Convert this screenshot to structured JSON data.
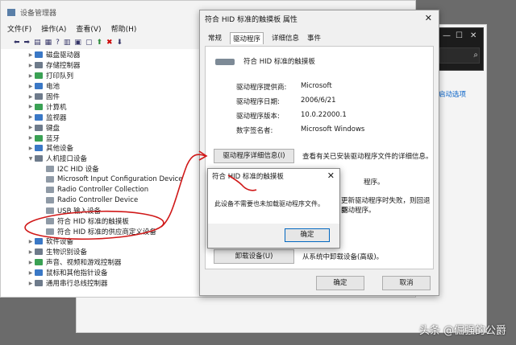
{
  "device_manager": {
    "title": "设备管理器",
    "menu": [
      "文件(F)",
      "操作(A)",
      "查看(V)",
      "帮助(H)"
    ],
    "tree": [
      {
        "label": "磁盘驱动器",
        "level": 1,
        "icon": "disk-icon"
      },
      {
        "label": "存储控制器",
        "level": 1,
        "icon": "storage-icon"
      },
      {
        "label": "打印队列",
        "level": 1,
        "icon": "printer-icon"
      },
      {
        "label": "电池",
        "level": 1,
        "icon": "battery-icon"
      },
      {
        "label": "固件",
        "level": 1,
        "icon": "firmware-icon"
      },
      {
        "label": "计算机",
        "level": 1,
        "icon": "computer-icon"
      },
      {
        "label": "监视器",
        "level": 1,
        "icon": "monitor-icon"
      },
      {
        "label": "键盘",
        "level": 1,
        "icon": "keyboard-icon"
      },
      {
        "label": "蓝牙",
        "level": 1,
        "icon": "bluetooth-icon"
      },
      {
        "label": "其他设备",
        "level": 1,
        "icon": "other-devices-icon"
      },
      {
        "label": "人机接口设备",
        "level": 1,
        "icon": "hid-icon",
        "expanded": true
      },
      {
        "label": "I2C HID 设备",
        "level": 2,
        "icon": "hid-device-icon"
      },
      {
        "label": "Microsoft Input Configuration Device",
        "level": 2,
        "icon": "hid-device-icon"
      },
      {
        "label": "Radio Controller Collection",
        "level": 2,
        "icon": "hid-device-icon"
      },
      {
        "label": "Radio Controller Device",
        "level": 2,
        "icon": "hid-device-icon"
      },
      {
        "label": "USB 输入设备",
        "level": 2,
        "icon": "hid-device-icon"
      },
      {
        "label": "符合 HID 标准的触摸板",
        "level": 2,
        "icon": "hid-device-icon"
      },
      {
        "label": "符合 HID 标准的供应商定义设备",
        "level": 2,
        "icon": "hid-device-icon"
      },
      {
        "label": "软件设备",
        "level": 1,
        "icon": "software-device-icon"
      },
      {
        "label": "生物识别设备",
        "level": 1,
        "icon": "biometric-icon"
      },
      {
        "label": "声音、视频和游戏控制器",
        "level": 1,
        "icon": "sound-icon"
      },
      {
        "label": "鼠标和其他指针设备",
        "level": 1,
        "icon": "mouse-icon"
      },
      {
        "label": "通用串行总线控制器",
        "level": 1,
        "icon": "usb-icon"
      }
    ]
  },
  "properties": {
    "title": "符合 HID 标准的触摸板 属性",
    "tabs": [
      "常规",
      "驱动程序",
      "详细信息",
      "事件"
    ],
    "device_name": "符合 HID 标准的触摸板",
    "fields": [
      {
        "key": "驱动程序提供商:",
        "value": "Microsoft"
      },
      {
        "key": "驱动程序日期:",
        "value": "2006/6/21"
      },
      {
        "key": "驱动程序版本:",
        "value": "10.0.22000.1"
      },
      {
        "key": "数字签名者:",
        "value": "Microsoft Windows"
      }
    ],
    "details_button": "驱动程序详细信息(I)",
    "details_desc": "查看有关已安装驱动程序文件的详细信息。",
    "partial_texts": [
      "程序。",
      "更新驱动程序时失败，则回退到",
      "驱动程序。"
    ],
    "uninstall_button": "卸载设备(U)",
    "uninstall_desc": "从系统中卸载设备(高级)。",
    "ok": "确定",
    "cancel": "取消"
  },
  "message": {
    "title": "符合 HID 标准的触摸板",
    "text": "此设备不需要也未加载驱动程序文件。",
    "ok": "确定"
  },
  "background": {
    "link": "启动选项"
  },
  "watermark": "头条 @倔强的公爵"
}
